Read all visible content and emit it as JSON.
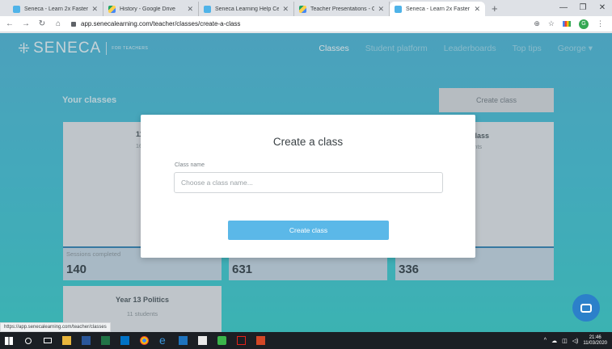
{
  "browser": {
    "tabs": [
      {
        "title": "Seneca - Learn 2x Faster",
        "favicon": "seneca-icon",
        "active": false
      },
      {
        "title": "History - Google Drive",
        "favicon": "google-drive-icon",
        "active": false
      },
      {
        "title": "Seneca Learning Help Cent",
        "favicon": "seneca-icon",
        "active": false
      },
      {
        "title": "Teacher Presentations - Go",
        "favicon": "google-drive-icon",
        "active": false
      },
      {
        "title": "Seneca - Learn 2x Faster",
        "favicon": "seneca-icon",
        "active": true
      }
    ],
    "url": "app.senecalearning.com/teacher/classes/create-a-class",
    "status_url": "https://app.senecalearning.com/teacher/classes",
    "profile_initial": "G"
  },
  "nav": {
    "logo": "SENECA",
    "logo_sub": "FOR TEACHERS",
    "links": [
      "Classes",
      "Student platform",
      "Leaderboards",
      "Top tips",
      "George ▾"
    ],
    "active_index": 0
  },
  "page": {
    "heading": "Your classes",
    "create_button": "Create class",
    "cards": [
      {
        "title": "11A",
        "sub": "16 st",
        "stat_label": "Sessions completed",
        "stat_value": "140"
      },
      {
        "title": "",
        "sub": "",
        "stat_label": "",
        "stat_value": "631"
      },
      {
        "title": "E History Class",
        "sub": "dents",
        "stat_label": "",
        "stat_value": "336"
      },
      {
        "title": "Year 13 Politics",
        "sub": "11 students",
        "stat_label": "",
        "stat_value": ""
      }
    ]
  },
  "modal": {
    "title": "Create a class",
    "label": "Class name",
    "placeholder": "Choose a class name...",
    "button": "Create class"
  },
  "taskbar": {
    "time": "21:46",
    "date": "11/03/2020"
  },
  "colors": {
    "accent": "#5bb8e8",
    "page_gradient_top": "#4bb5d6",
    "page_gradient_bottom": "#35cdc9",
    "chat_button": "#2c80ca"
  }
}
